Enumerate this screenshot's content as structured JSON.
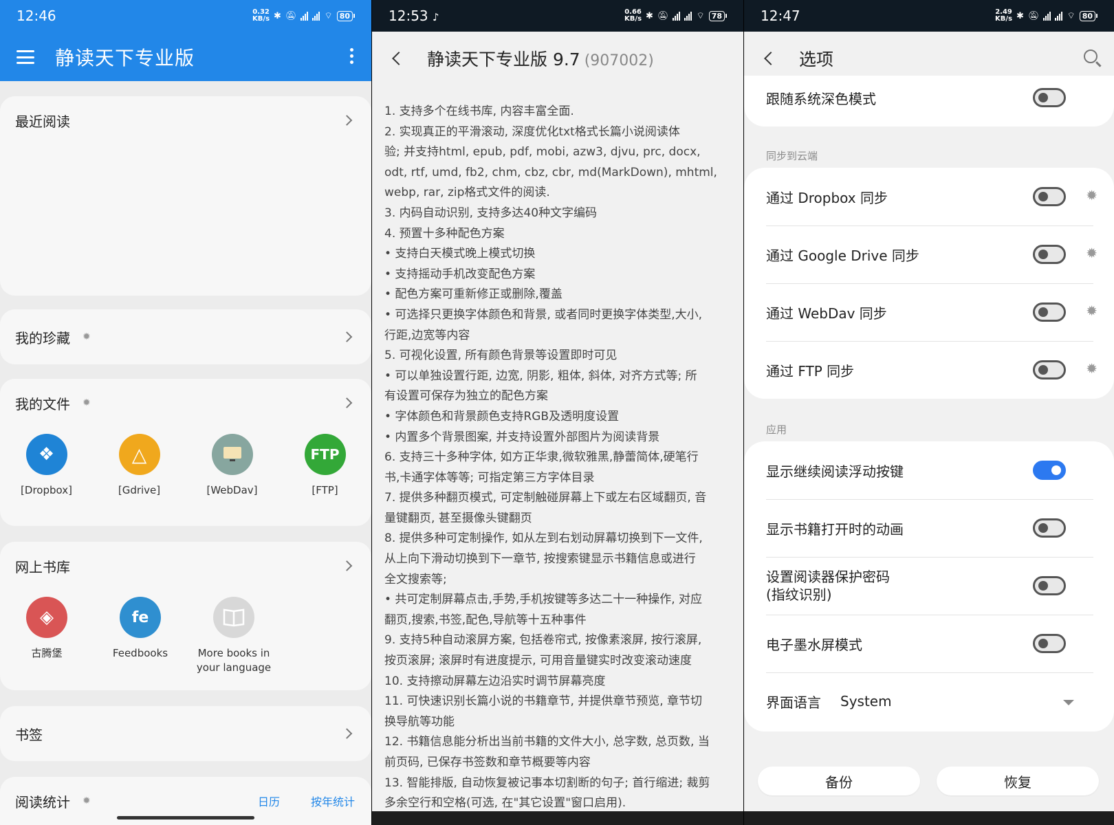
{
  "panel1": {
    "status": {
      "time": "12:46",
      "speed": "0.32\nKB/s",
      "battery": "80"
    },
    "title": "静读天下专业版",
    "recent": {
      "title": "最近阅读"
    },
    "favorites": {
      "title": "我的珍藏"
    },
    "files": {
      "title": "我的文件",
      "items": [
        {
          "label": "[Dropbox]",
          "icon": "dropbox-icon",
          "color": "#1f84d6"
        },
        {
          "label": "[Gdrive]",
          "icon": "google-drive-icon",
          "color": "#f0a81d"
        },
        {
          "label": "[WebDav]",
          "icon": "webdav-monitor-icon",
          "color": "#87a69f"
        },
        {
          "label": "[FTP]",
          "icon": "ftp-icon",
          "color": "#33a838",
          "text": "FTP"
        }
      ]
    },
    "online": {
      "title": "网上书库",
      "items": [
        {
          "label": "古腾堡",
          "icon": "gutenberg-icon",
          "color": "#d95555"
        },
        {
          "label": "Feedbooks",
          "icon": "feedbooks-icon",
          "color": "#2f8fd0",
          "text": "fe"
        },
        {
          "label": "More books in your language",
          "icon": "book-icon",
          "color": "#d8d8d8"
        }
      ]
    },
    "bookmarks": {
      "title": "书签"
    },
    "stats": {
      "title": "阅读统计",
      "calendar": "日历",
      "yearly": "按年统计"
    }
  },
  "panel2": {
    "status": {
      "time": "12:53",
      "speed": "0.66\nKB/s",
      "battery": "78"
    },
    "title": "静读天下专业版 9.7",
    "build": "(907002)",
    "lines": [
      "1. 支持多个在线书库, 内容丰富全面.",
      "2. 实现真正的平滑滚动, 深度优化txt格式长篇小说阅读体",
      "验; 并支持html, epub, pdf, mobi, azw3, djvu, prc, docx,",
      "odt, rtf, umd, fb2, chm, cbz, cbr, md(MarkDown), mhtml,",
      "webp, rar, zip格式文件的阅读.",
      "3. 内码自动识别, 支持多达40种文字编码",
      "4. 预置十多种配色方案",
      " • 支持白天模式晚上模式切换",
      " • 支持摇动手机改变配色方案",
      " • 配色方案可重新修正或删除,覆盖",
      " • 可选择只更换字体颜色和背景, 或者同时更换字体类型,大小,",
      "行距,边宽等内容",
      "5. 可视化设置, 所有颜色背景等设置即时可见",
      " • 可以单独设置行距, 边宽, 阴影, 粗体, 斜体, 对齐方式等; 所",
      "有设置可保存为独立的配色方案",
      " • 字体颜色和背景颜色支持RGB及透明度设置",
      " • 内置多个背景图案, 并支持设置外部图片为阅读背景",
      "6. 支持三十多种字体, 如方正华隶,微软雅黑,静蕾简体,硬笔行",
      "书,卡通字体等等; 可指定第三方字体目录",
      "7. 提供多种翻页模式, 可定制触碰屏幕上下或左右区域翻页, 音",
      "量键翻页, 甚至摄像头键翻页",
      "8. 提供多种可定制操作, 如从左到右划动屏幕切换到下一文件,",
      "从上向下滑动切换到下一章节, 按搜索键显示书籍信息或进行",
      "全文搜索等;",
      " • 共可定制屏幕点击,手势,手机按键等多达二十一种操作, 对应",
      "翻页,搜索,书签,配色,导航等十五种事件",
      "9. 支持5种自动滚屏方案, 包括卷帘式, 按像素滚屏, 按行滚屏,",
      "按页滚屏; 滚屏时有进度提示, 可用音量键实时改变滚动速度",
      "10. 支持擦动屏幕左边沿实时调节屏幕亮度",
      "11. 可快速识别长篇小说的书籍章节, 并提供章节预览, 章节切",
      "换导航等功能",
      "12. 书籍信息能分析出当前书籍的文件大小, 总字数, 总页数, 当",
      "前页码, 已保存书签数和章节概要等内容",
      "13. 智能排版, 自动恢复被记事本切割断的句子; 首行缩进; 裁剪",
      "多余空行和空格(可选, 在\"其它设置\"窗口启用)."
    ]
  },
  "panel3": {
    "status": {
      "time": "12:47",
      "speed": "2.49\nKB/s",
      "battery": "80"
    },
    "title": "选项",
    "follow_dark": {
      "label": "跟随系统深色模式",
      "on": false
    },
    "sync_section": "同步到云端",
    "sync": [
      {
        "label": "通过 Dropbox 同步",
        "on": false
      },
      {
        "label": "通过 Google Drive 同步",
        "on": false
      },
      {
        "label": "通过 WebDav 同步",
        "on": false
      },
      {
        "label": "通过 FTP 同步",
        "on": false
      }
    ],
    "app_section": "应用",
    "app": [
      {
        "label": "显示继续阅读浮动按键",
        "on": true
      },
      {
        "label": "显示书籍打开时的动画",
        "on": false
      },
      {
        "label": "设置阅读器保护密码\n(指纹识别)",
        "on": false
      },
      {
        "label": "电子墨水屏模式",
        "on": false
      }
    ],
    "language": {
      "label": "界面语言",
      "value": "System"
    },
    "backup": "备份",
    "restore": "恢复"
  },
  "colors": {
    "accent": "#2287e8",
    "switch_on": "#2c79f0"
  }
}
